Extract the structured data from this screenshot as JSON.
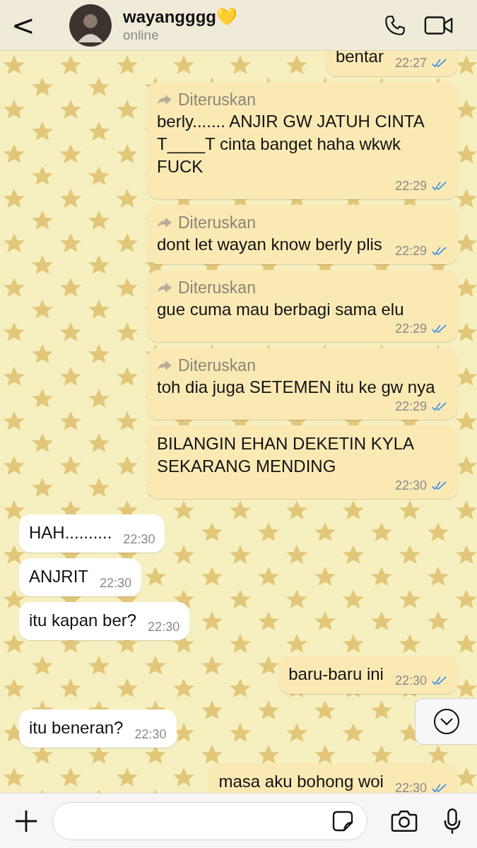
{
  "header": {
    "back": "<",
    "name": "wayangggg💛",
    "status": "online"
  },
  "messages": [
    {
      "kind": "out",
      "text": "bentar",
      "time": "22:27",
      "read": true
    },
    {
      "kind": "out",
      "forwarded": "Diteruskan",
      "text": "berly....... ANJIR GW JATUH CINTA T____T cinta banget haha wkwk FUCK",
      "time": "22:29",
      "read": true
    },
    {
      "kind": "out",
      "forwarded": "Diteruskan",
      "text": "dont let wayan know berly plis",
      "time": "22:29",
      "read": true
    },
    {
      "kind": "out",
      "forwarded": "Diteruskan",
      "text": "gue cuma mau berbagi sama elu",
      "time": "22:29",
      "read": true
    },
    {
      "kind": "out",
      "forwarded": "Diteruskan",
      "text": "toh dia juga SETEMEN itu ke gw nya",
      "time": "22:29",
      "read": true
    },
    {
      "kind": "out",
      "text": "BILANGIN EHAN DEKETIN KYLA SEKARANG MENDING",
      "time": "22:30",
      "read": true
    },
    {
      "kind": "in",
      "text": "HAH..........",
      "time": "22:30"
    },
    {
      "kind": "in",
      "text": "ANJRIT",
      "time": "22:30"
    },
    {
      "kind": "in",
      "text": "itu kapan ber?",
      "time": "22:30"
    },
    {
      "kind": "out",
      "text": "baru-baru ini",
      "time": "22:30",
      "read": true
    },
    {
      "kind": "in",
      "text": "itu beneran?",
      "time": "22:30"
    },
    {
      "kind": "out",
      "text": "masa aku bohong woi",
      "time": "22:30",
      "read": true
    }
  ]
}
